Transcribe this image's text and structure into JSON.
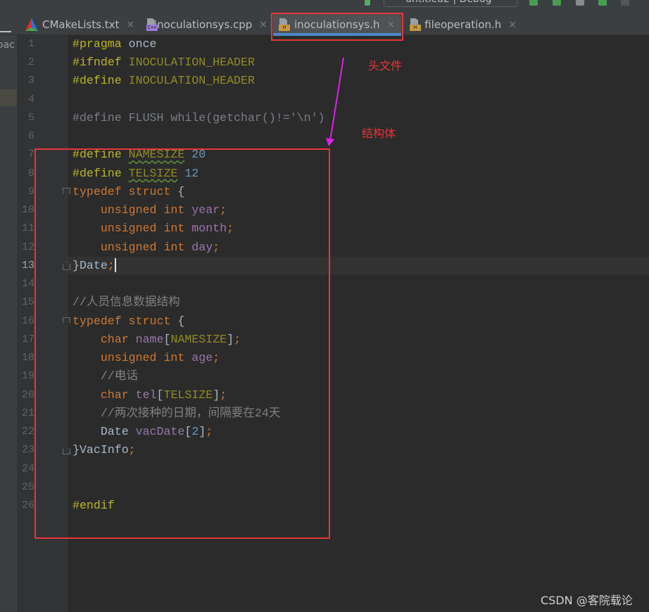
{
  "toolbar": {
    "run_config": "untitled2 | Debug"
  },
  "tabs": [
    {
      "label": "CMakeLists.txt",
      "icon": "cmake-icon",
      "active": false
    },
    {
      "label": "inoculationsys.cpp",
      "icon": "cpp-file-icon",
      "badge": "C++",
      "active": false
    },
    {
      "label": "inoculationsys.h",
      "icon": "header-file-icon",
      "badge": "H",
      "active": true
    },
    {
      "label": "fileoperation.h",
      "icon": "header-file-icon",
      "badge": "H",
      "active": false
    }
  ],
  "close_glyph": "×",
  "project_panel": {
    "label": "oac"
  },
  "editor": {
    "current_line": 13,
    "fold_lines": [
      9,
      13,
      16,
      23
    ],
    "lines": [
      [
        [
          "pp",
          "#pragma"
        ],
        [
          "def",
          " once"
        ]
      ],
      [
        [
          "pp",
          "#ifndef"
        ],
        [
          "mac",
          " INOCULATION_HEADER"
        ]
      ],
      [
        [
          "pp",
          "#define"
        ],
        [
          "mac",
          " INOCULATION_HEADER"
        ]
      ],
      [],
      [
        [
          "dis",
          "#define FLUSH while(getchar()!='\\n')"
        ]
      ],
      [],
      [
        [
          "pp",
          "#define "
        ],
        [
          "macw",
          "NAMESIZE"
        ],
        [
          "num",
          " 20"
        ]
      ],
      [
        [
          "pp",
          "#define "
        ],
        [
          "macw",
          "TELSIZE"
        ],
        [
          "num",
          " 12"
        ]
      ],
      [
        [
          "kw",
          "typedef struct "
        ],
        [
          "def",
          "{"
        ]
      ],
      [
        [
          "def",
          "    "
        ],
        [
          "kw",
          "unsigned int "
        ],
        [
          "fld",
          "year"
        ],
        [
          "kw",
          ";"
        ]
      ],
      [
        [
          "def",
          "    "
        ],
        [
          "kw",
          "unsigned int "
        ],
        [
          "fld",
          "month"
        ],
        [
          "kw",
          ";"
        ]
      ],
      [
        [
          "def",
          "    "
        ],
        [
          "kw",
          "unsigned int "
        ],
        [
          "fld",
          "day"
        ],
        [
          "kw",
          ";"
        ]
      ],
      [
        [
          "def",
          "}Date"
        ],
        [
          "kw",
          ";"
        ]
      ],
      [],
      [
        [
          "cm",
          "//人员信息数据结构"
        ]
      ],
      [
        [
          "kw",
          "typedef struct "
        ],
        [
          "def",
          "{"
        ]
      ],
      [
        [
          "def",
          "    "
        ],
        [
          "kw",
          "char "
        ],
        [
          "fld",
          "name"
        ],
        [
          "def",
          "["
        ],
        [
          "mac",
          "NAMESIZE"
        ],
        [
          "def",
          "]"
        ],
        [
          "kw",
          ";"
        ]
      ],
      [
        [
          "def",
          "    "
        ],
        [
          "kw",
          "unsigned int "
        ],
        [
          "fld",
          "age"
        ],
        [
          "kw",
          ";"
        ]
      ],
      [
        [
          "cm",
          "    //电话"
        ]
      ],
      [
        [
          "def",
          "    "
        ],
        [
          "kw",
          "char "
        ],
        [
          "fld",
          "tel"
        ],
        [
          "def",
          "["
        ],
        [
          "mac",
          "TELSIZE"
        ],
        [
          "def",
          "]"
        ],
        [
          "kw",
          ";"
        ]
      ],
      [
        [
          "cm",
          "    //两次接种的日期，间隔要在24天"
        ]
      ],
      [
        [
          "def",
          "    Date "
        ],
        [
          "fld",
          "vacDate"
        ],
        [
          "def",
          "["
        ],
        [
          "num",
          "2"
        ],
        [
          "def",
          "]"
        ],
        [
          "kw",
          ";"
        ]
      ],
      [
        [
          "def",
          "}VacInfo"
        ],
        [
          "kw",
          ";"
        ]
      ],
      [],
      [],
      [
        [
          "pp",
          "#endif"
        ]
      ]
    ]
  },
  "annotations": {
    "header_label": "头文件",
    "struct_label": "结构体",
    "box_color": "#e8353b",
    "arrow_color": "#e020e8"
  },
  "watermark": "CSDN @客院载论"
}
